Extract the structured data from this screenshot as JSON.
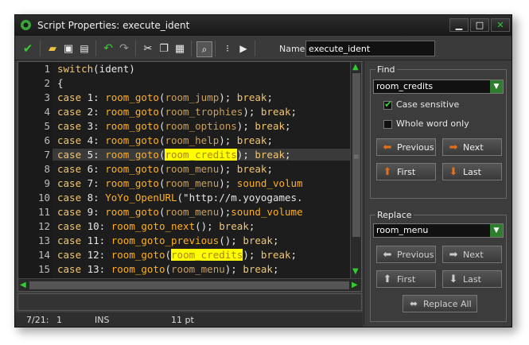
{
  "window": {
    "title": "Script Properties: execute_ident",
    "buttons": [
      "minimize",
      "maximize",
      "close"
    ]
  },
  "toolbar": {
    "name_label": "Name:",
    "name_value": "execute_ident",
    "icons": [
      "ok-check-icon",
      "open-folder-icon",
      "save-icon",
      "print-icon",
      "undo-icon",
      "redo-icon",
      "cut-icon",
      "copy-icon",
      "paste-icon",
      "find-icon",
      "goto-line-icon",
      "check-script-icon"
    ]
  },
  "editor": {
    "lines": [
      {
        "n": "1",
        "t": "switch(ident)"
      },
      {
        "n": "2",
        "t": "{"
      },
      {
        "n": "3",
        "t": "case 1: room_goto(room_jump); break;"
      },
      {
        "n": "4",
        "t": "case 2: room_goto(room_trophies); break;"
      },
      {
        "n": "5",
        "t": "case 3: room_goto(room_options); break;"
      },
      {
        "n": "6",
        "t": "case 4: room_goto(room_help); break;"
      },
      {
        "n": "7",
        "t": "case 5: room_goto(room_credits); break;"
      },
      {
        "n": "8",
        "t": "case 6: room_goto(room_menu); break;"
      },
      {
        "n": "9",
        "t": "case 7: room_goto(room_menu); sound_volum"
      },
      {
        "n": "10",
        "t": "case 8: YoYo_OpenURL(\"http://m.yoyogames."
      },
      {
        "n": "11",
        "t": "case 9: room_goto(room_menu);sound_volume"
      },
      {
        "n": "12",
        "t": "case 10: room_goto_next(); break;"
      },
      {
        "n": "13",
        "t": "case 11: room_goto_previous(); break;"
      },
      {
        "n": "14",
        "t": "case 12: room_goto(room_credits); break;"
      },
      {
        "n": "15",
        "t": "case 13: room_goto(room_menu); break;"
      }
    ]
  },
  "status": {
    "position": "7/21:",
    "column": "1",
    "mode": "INS",
    "font_size": "11 pt"
  },
  "find": {
    "label": "Find",
    "value": "room_credits",
    "case_sensitive": "Case sensitive",
    "whole_word": "Whole word only",
    "previous": "Previous",
    "next": "Next",
    "first": "First",
    "last": "Last"
  },
  "replace": {
    "label": "Replace",
    "value": "room_menu",
    "previous": "Previous",
    "next": "Next",
    "first": "First",
    "last": "Last",
    "replace_all": "Replace All"
  },
  "colors": {
    "keyword": "#f0c674",
    "highlight": "#ffff00",
    "accent_green": "#33cc33",
    "orange_arrow": "#e8701a"
  }
}
